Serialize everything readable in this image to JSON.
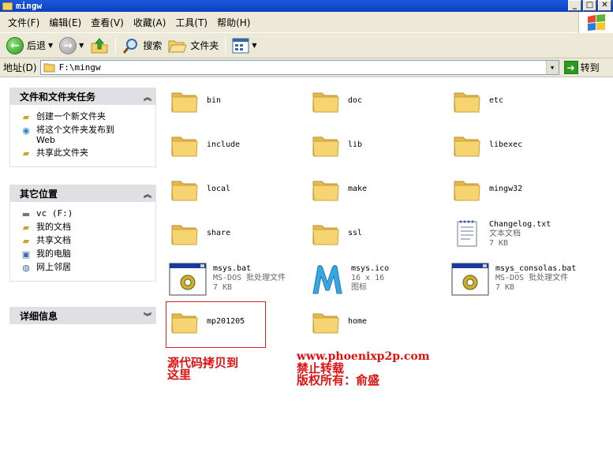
{
  "window": {
    "title": "mingw"
  },
  "menu": [
    "文件(F)",
    "编辑(E)",
    "查看(V)",
    "收藏(A)",
    "工具(T)",
    "帮助(H)"
  ],
  "toolbar": {
    "back": "后退",
    "search": "搜索",
    "folders": "文件夹"
  },
  "address": {
    "label": "地址(D)",
    "value": "F:\\mingw",
    "go": "转到"
  },
  "tasks": {
    "file_tasks": {
      "title": "文件和文件夹任务",
      "items": [
        "创建一个新文件夹",
        "将这个文件夹发布到 Web",
        "共享此文件夹"
      ]
    },
    "other_places": {
      "title": "其它位置",
      "items": [
        "vc (F:)",
        "我的文档",
        "共享文档",
        "我的电脑",
        "网上邻居"
      ]
    },
    "details": {
      "title": "详细信息"
    }
  },
  "files": [
    {
      "name": "bin",
      "type": "folder"
    },
    {
      "name": "doc",
      "type": "folder"
    },
    {
      "name": "etc",
      "type": "folder"
    },
    {
      "name": "include",
      "type": "folder"
    },
    {
      "name": "lib",
      "type": "folder"
    },
    {
      "name": "libexec",
      "type": "folder"
    },
    {
      "name": "local",
      "type": "folder"
    },
    {
      "name": "make",
      "type": "folder"
    },
    {
      "name": "mingw32",
      "type": "folder"
    },
    {
      "name": "share",
      "type": "folder"
    },
    {
      "name": "ssl",
      "type": "folder"
    },
    {
      "name": "Changelog.txt",
      "type": "text",
      "desc": "文本文档",
      "size": "7 KB"
    },
    {
      "name": "msys.bat",
      "type": "bat",
      "desc": "MS-DOS 批处理文件",
      "size": "7 KB"
    },
    {
      "name": "msys.ico",
      "type": "ico",
      "desc": "16 x 16",
      "size": "图标"
    },
    {
      "name": "msys_consolas.bat",
      "type": "bat",
      "desc": "MS-DOS 批处理文件",
      "size": "7 KB"
    },
    {
      "name": "mp201205",
      "type": "folder"
    },
    {
      "name": "home",
      "type": "folder"
    }
  ],
  "annotations": {
    "left": [
      "源代码拷贝到",
      "这里"
    ],
    "right": [
      "www.phoenixp2p.com",
      "禁止转载",
      "版权所有：俞盛"
    ]
  },
  "colors": {
    "titlebar": "#0a3fc0",
    "annotation": "#e01010",
    "folder": "#f6d472"
  }
}
